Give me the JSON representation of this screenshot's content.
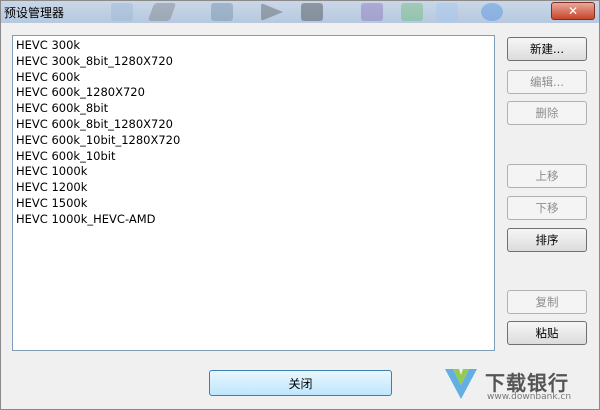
{
  "window": {
    "title": "预设管理器",
    "close_glyph": "✕"
  },
  "presets": [
    "HEVC 300k",
    "HEVC 300k_8bit_1280X720",
    "HEVC 600k",
    "HEVC 600k_1280X720",
    "HEVC 600k_8bit",
    "HEVC 600k_8bit_1280X720",
    "HEVC 600k_10bit_1280X720",
    "HEVC 600k_10bit",
    "HEVC 1000k",
    "HEVC 1200k",
    "HEVC 1500k",
    "HEVC 1000k_HEVC-AMD"
  ],
  "buttons": {
    "new": "新建...",
    "edit": "编辑...",
    "delete": "删除",
    "move_up": "上移",
    "move_down": "下移",
    "sort": "排序",
    "copy": "复制",
    "paste": "粘贴",
    "close": "关闭"
  },
  "watermark": {
    "text": "下载银行",
    "url": "www.downbank.cn"
  },
  "colors": {
    "title_bg": "#c9d7e8",
    "close_red": "#c8452c",
    "default_btn": "#bee6fd"
  }
}
